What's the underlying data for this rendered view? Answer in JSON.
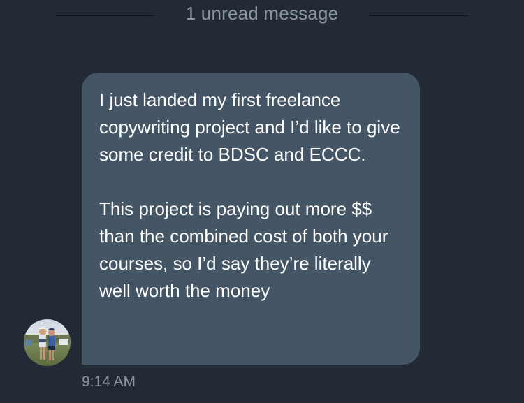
{
  "divider": {
    "label": "1 unread message"
  },
  "message": {
    "paragraphs": [
      "I just landed my first freelance copywriting project and I’d like to give some credit to BDSC and ECCC.",
      "This project is paying out more $$ than the combined cost of both your courses, so I’d say they’re literally well worth the money"
    ],
    "time": "9:14 AM"
  },
  "colors": {
    "background": "#222a35",
    "bubble": "#445566",
    "muted_text": "#8b96a3",
    "message_text": "#ffffff"
  }
}
